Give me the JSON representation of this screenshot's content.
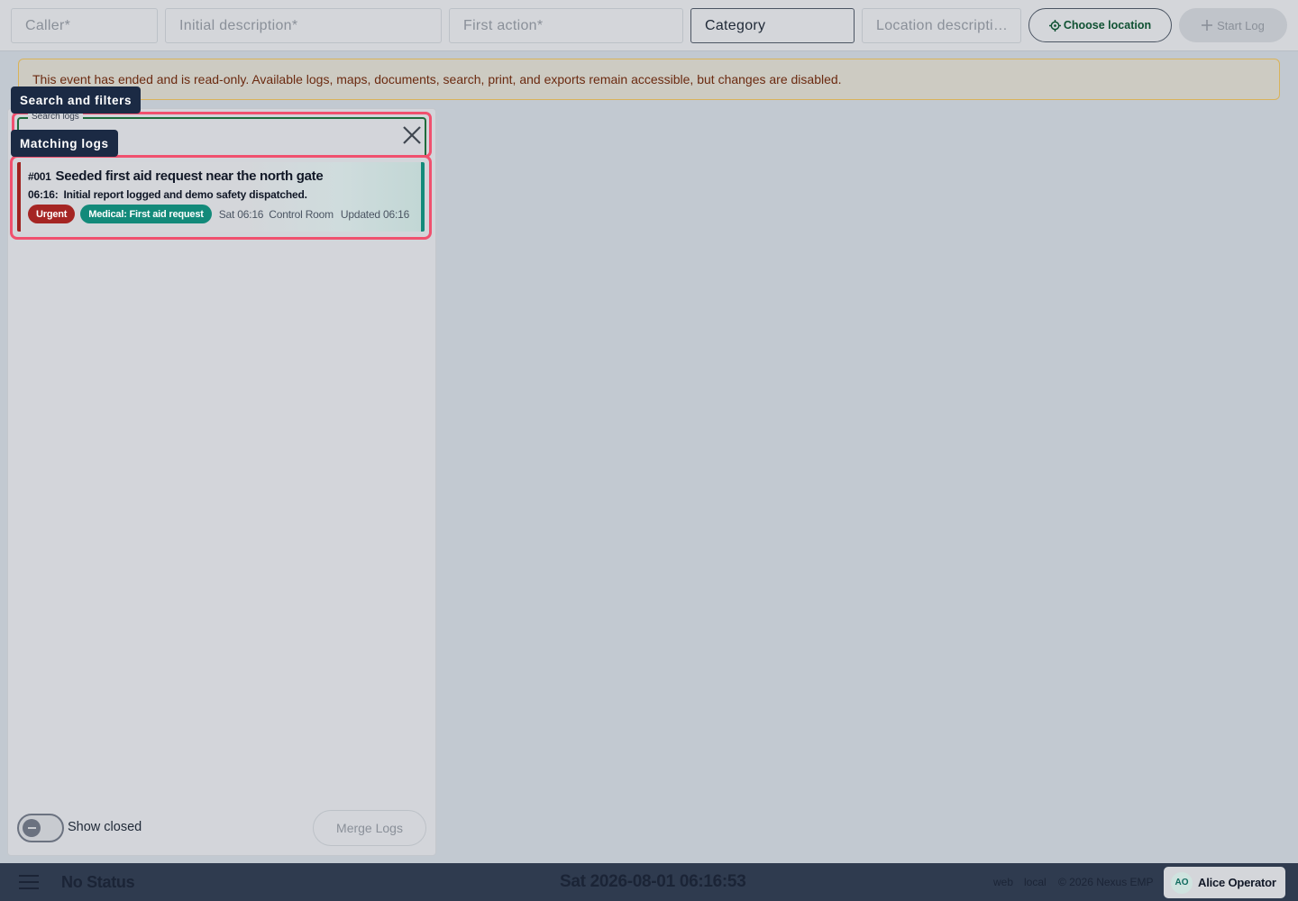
{
  "toolbar": {
    "caller_placeholder": "Caller*",
    "initial_description_placeholder": "Initial description*",
    "first_action_placeholder": "First action*",
    "category_label": "Category",
    "location_description_placeholder": "Location descripti…",
    "choose_location_label": "Choose location",
    "start_log_label": "Start Log"
  },
  "banner": {
    "text": "This event has ended and is read-only. Available logs, maps, documents, search, print, and exports remain accessible, but changes are disabled."
  },
  "tooltips": {
    "search_and_filters": "Search and filters",
    "matching_logs": "Matching logs"
  },
  "search": {
    "legend": "Search logs",
    "value": ""
  },
  "logs": [
    {
      "number": "#001",
      "title": "Seeded first aid request near the north gate",
      "time": "06:16:",
      "entry": "Initial report logged and demo safety dispatched.",
      "priority": "Urgent",
      "category": "Medical: First aid request",
      "created": "Sat 06:16",
      "location": "Control Room",
      "updated": "Updated 06:16"
    }
  ],
  "filters": {
    "show_closed_label": "Show closed",
    "show_closed": false,
    "merge_label": "Merge Logs"
  },
  "footer": {
    "status": "No Status",
    "datetime": "Sat 2026-08-01 06:16:53",
    "platform": "web",
    "mode": "local",
    "copyright": "© 2026 Nexus EMP",
    "user_initials": "AO",
    "user_name": "Alice Operator"
  },
  "colors": {
    "urgent": "#a52523",
    "category": "#138a7a",
    "highlight": "#f0506e",
    "footer_bg": "#2f3b4f"
  }
}
